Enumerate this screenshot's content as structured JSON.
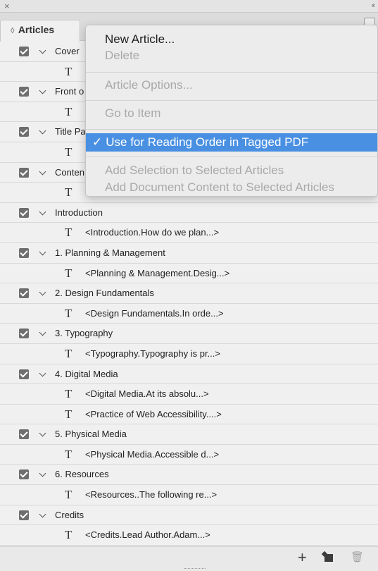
{
  "panel": {
    "close_glyph": "×",
    "collapse_glyph": "‹‹",
    "tab_label": "Articles",
    "tab_arrows": "◊"
  },
  "articles": [
    {
      "label": "Cover",
      "items": [
        ""
      ]
    },
    {
      "label": "Front o",
      "items": [
        ""
      ]
    },
    {
      "label": "Title Pa",
      "items": [
        ""
      ]
    },
    {
      "label": "Conten",
      "items": [
        ""
      ]
    },
    {
      "label": "Introduction",
      "items": [
        "<Introduction.How do we plan...>"
      ]
    },
    {
      "label": "1. Planning & Management",
      "items": [
        "<Planning & Management.Desig...>"
      ]
    },
    {
      "label": "2. Design Fundamentals",
      "items": [
        "<Design Fundamentals.In orde...>"
      ]
    },
    {
      "label": "3. Typography",
      "items": [
        "<Typography.Typography is pr...>"
      ]
    },
    {
      "label": "4. Digital Media",
      "items": [
        "<Digital Media.At its absolu...>",
        "<Practice of Web Accessibility....>"
      ]
    },
    {
      "label": "5. Physical Media",
      "items": [
        "<Physical Media.Accessible d...>"
      ]
    },
    {
      "label": "6. Resources",
      "items": [
        "<Resources..The following re...>"
      ]
    },
    {
      "label": "Credits",
      "items": [
        "<Credits.Lead Author.Adam...>"
      ]
    }
  ],
  "item_icon": "T",
  "menu": {
    "new_article": "New Article...",
    "delete": "Delete",
    "article_options": "Article Options...",
    "go_to_item": "Go to Item",
    "check": "✓",
    "use_for_reading_order": "Use for Reading Order in Tagged PDF",
    "add_selection": "Add Selection to Selected Articles",
    "add_document_content": "Add Document Content to Selected Articles"
  },
  "bottom": {
    "add_glyph": "+",
    "trash_glyph": "🗑"
  },
  "colors": {
    "selected": "#4a90e2",
    "checkbox": "#6e6e6e"
  }
}
